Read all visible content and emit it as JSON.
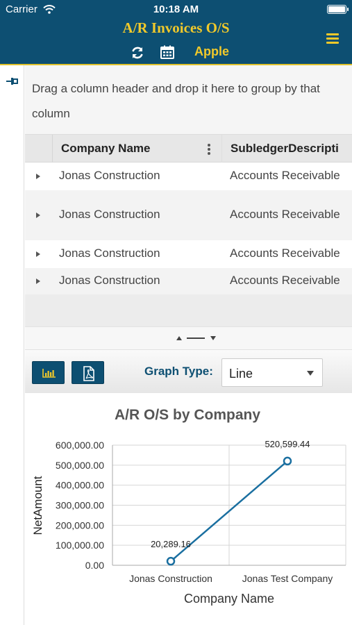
{
  "status_bar": {
    "carrier": "Carrier",
    "time": "10:18 AM"
  },
  "header": {
    "title": "A/R Invoices O/S",
    "company": "Apple",
    "icons": [
      "refresh-icon",
      "calendar-icon",
      "menu-icon"
    ]
  },
  "group_panel": {
    "text": "Drag a column header and drop it here to group by that column"
  },
  "grid": {
    "columns": [
      "Company Name",
      "SubledgerDescripti"
    ],
    "rows": [
      {
        "company": "Jonas Construction",
        "subledger": "Accounts Receivable"
      },
      {
        "company": "Jonas Construction",
        "subledger": "Accounts Receivable"
      },
      {
        "company": "Jonas Construction",
        "subledger": "Accounts Receivable"
      },
      {
        "company": "Jonas Construction",
        "subledger": "Accounts Receivable"
      }
    ]
  },
  "toolbar": {
    "graph_type_label": "Graph Type:",
    "graph_type_value": "Line",
    "icons": [
      "bar-chart-icon",
      "pdf-icon"
    ]
  },
  "colors": {
    "header_bg": "#0d4f72",
    "accent": "#f1c92a",
    "series": "#1a6fa0"
  },
  "chart_data": {
    "type": "line",
    "title": "A/R O/S by Company",
    "xlabel": "Company Name",
    "ylabel": "NetAmount",
    "categories": [
      "Jonas Construction",
      "Jonas Test Company"
    ],
    "series": [
      {
        "values": [
          20289.16,
          520599.44
        ],
        "data_labels": [
          "20,289.16",
          "520,599.44"
        ]
      }
    ],
    "ylim": [
      0,
      600000
    ],
    "yticks": [
      0,
      100000,
      200000,
      300000,
      400000,
      500000,
      600000
    ],
    "ytick_labels": [
      "0.00",
      "100,000.00",
      "200,000.00",
      "300,000.00",
      "400,000.00",
      "500,000.00",
      "600,000.00"
    ],
    "grid": true,
    "legend": "none"
  }
}
